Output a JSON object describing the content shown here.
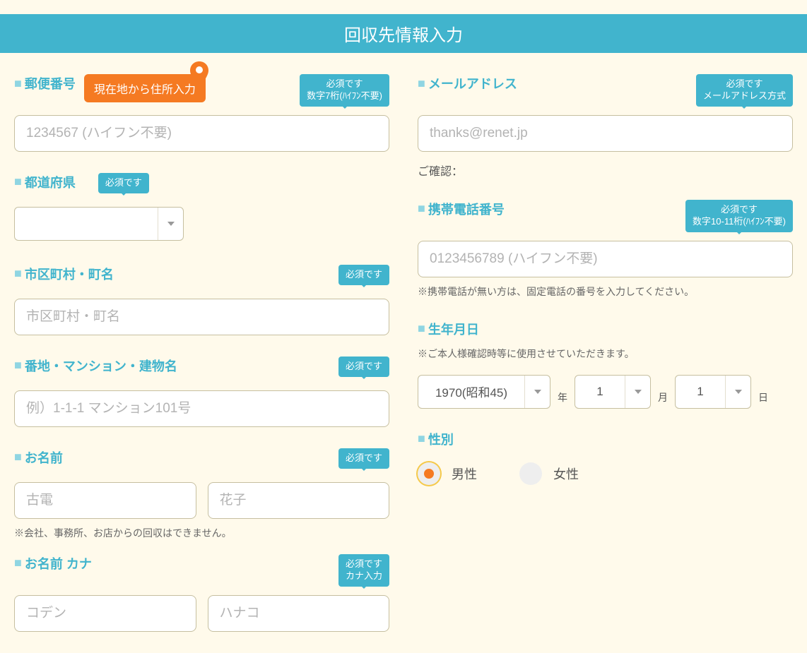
{
  "header": {
    "title": "回収先情報入力"
  },
  "postal": {
    "label": "郵便番号",
    "location_btn": "現在地から住所入力",
    "tooltip_line1": "必須です",
    "tooltip_line2": "数字7桁(ﾊｲﾌﾝ不要)",
    "placeholder": "1234567 (ハイフン不要)"
  },
  "prefecture": {
    "label": "都道府県",
    "tooltip": "必須です",
    "value": ""
  },
  "city": {
    "label": "市区町村・町名",
    "tooltip": "必須です",
    "placeholder": "市区町村・町名"
  },
  "address": {
    "label": "番地・マンション・建物名",
    "tooltip": "必須です",
    "placeholder": "例）1-1-1 マンション101号"
  },
  "name": {
    "label": "お名前",
    "tooltip": "必須です",
    "placeholder_last": "古電",
    "placeholder_first": "花子",
    "helper": "※会社、事務所、お店からの回収はできません。"
  },
  "kana": {
    "label": "お名前 カナ",
    "tooltip_line1": "必須です",
    "tooltip_line2": "カナ入力",
    "placeholder_last": "コデン",
    "placeholder_first": "ハナコ"
  },
  "email": {
    "label": "メールアドレス",
    "tooltip_line1": "必須です",
    "tooltip_line2": "メールアドレス方式",
    "placeholder": "thanks@renet.jp",
    "confirm_label": "ご確認："
  },
  "phone": {
    "label": "携帯電話番号",
    "tooltip_line1": "必須です",
    "tooltip_line2": "数字10-11桁(ﾊｲﾌﾝ不要)",
    "placeholder": "0123456789 (ハイフン不要)",
    "helper": "※携帯電話が無い方は、固定電話の番号を入力してください。"
  },
  "dob": {
    "label": "生年月日",
    "note": "※ご本人様確認時等に使用させていただきます。",
    "year_value": "1970(昭和45)",
    "year_unit": "年",
    "month_value": "1",
    "month_unit": "月",
    "day_value": "1",
    "day_unit": "日"
  },
  "gender": {
    "label": "性別",
    "male": "男性",
    "female": "女性",
    "selected": "male"
  }
}
